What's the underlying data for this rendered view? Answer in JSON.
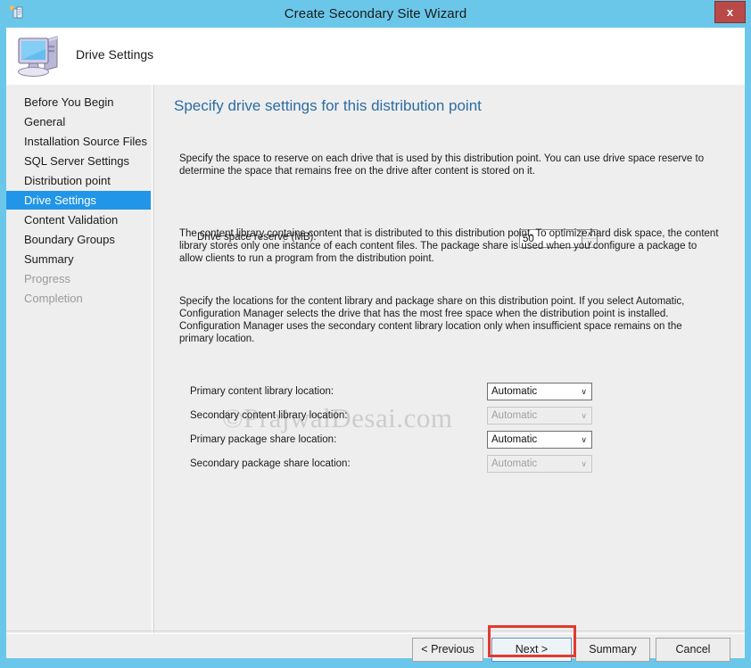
{
  "window": {
    "title": "Create Secondary Site Wizard",
    "icon": "wizard-document-icon",
    "close_label": "x",
    "frame_color": "#6ac7ea"
  },
  "header": {
    "title": "Drive Settings",
    "icon": "computer-monitor-icon"
  },
  "sidebar": {
    "items": [
      {
        "label": "Before You Begin",
        "state": "normal"
      },
      {
        "label": "General",
        "state": "normal"
      },
      {
        "label": "Installation Source Files",
        "state": "normal"
      },
      {
        "label": "SQL Server Settings",
        "state": "normal"
      },
      {
        "label": "Distribution point",
        "state": "normal"
      },
      {
        "label": "Drive Settings",
        "state": "selected"
      },
      {
        "label": "Content Validation",
        "state": "normal"
      },
      {
        "label": "Boundary Groups",
        "state": "normal"
      },
      {
        "label": "Summary",
        "state": "normal"
      },
      {
        "label": "Progress",
        "state": "disabled"
      },
      {
        "label": "Completion",
        "state": "disabled"
      }
    ],
    "selected_color": "#2196e8"
  },
  "content": {
    "heading": "Specify drive settings for this distribution point",
    "paragraph1": "Specify the space to reserve on each drive that is used by this distribution point. You can use drive space reserve to determine the space that remains free on the drive after content is stored on it.",
    "paragraph2": "The content library contains content that is distributed to this distribution point. To optimize hard disk space, the content library stores only one instance of each content files. The package share is used when you configure a package to allow clients to run a program from the distribution point.",
    "paragraph3": "Specify the locations for the content library and package share on this distribution point. If you select Automatic, Configuration Manager selects the drive that has the most free space when the distribution point is installed. Configuration Manager uses the secondary content library location only when insufficient space remains on the primary location.",
    "drive_space_reserve": {
      "label": "Drive space reserve (MB):",
      "value": "50",
      "spinner_up": "∧",
      "spinner_down": "∨"
    },
    "location_rows": [
      {
        "label": "Primary content library location:",
        "value": "Automatic",
        "disabled": false
      },
      {
        "label": "Secondary content library location:",
        "value": "Automatic",
        "disabled": true
      },
      {
        "label": "Primary package share location:",
        "value": "Automatic",
        "disabled": false
      },
      {
        "label": "Secondary package share location:",
        "value": "Automatic",
        "disabled": true
      }
    ],
    "combo_arrow": "∨",
    "watermark": "©PrajwalDesai.com"
  },
  "footer": {
    "buttons": [
      {
        "label": "< Previous",
        "focused": false,
        "highlighted": false
      },
      {
        "label": "Next >",
        "focused": true,
        "highlighted": true
      },
      {
        "label": "Summary",
        "focused": false,
        "highlighted": false
      },
      {
        "label": "Cancel",
        "focused": false,
        "highlighted": false
      }
    ],
    "highlight_color": "#e23a2e"
  }
}
